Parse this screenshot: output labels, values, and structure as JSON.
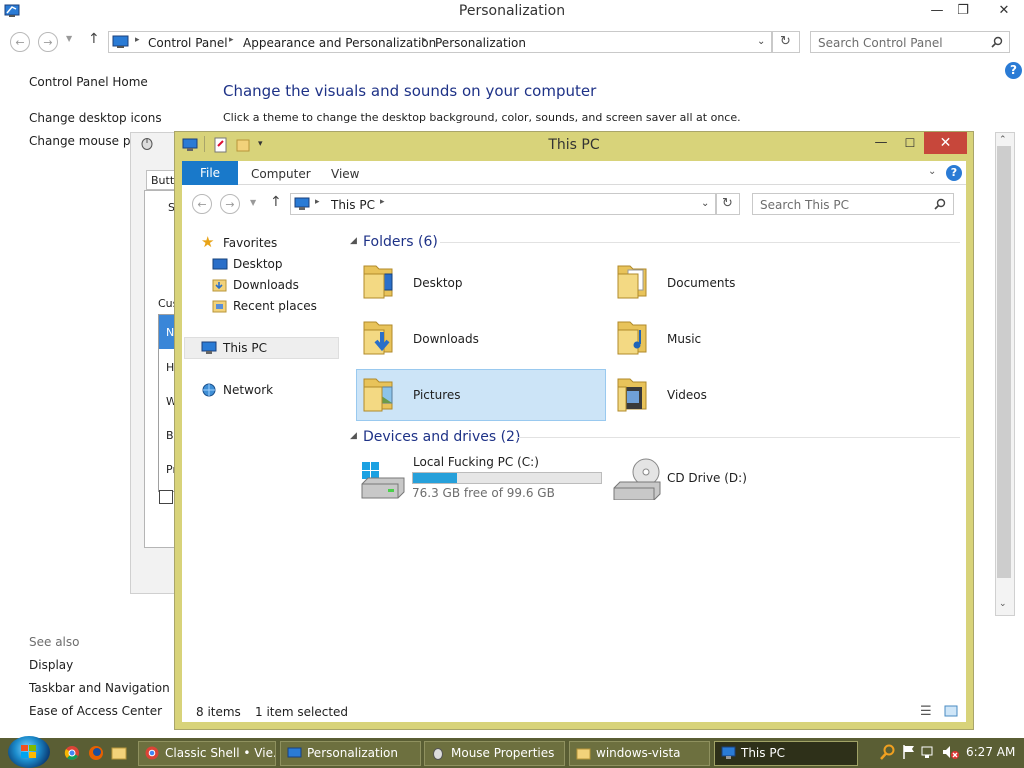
{
  "control_panel": {
    "title": "Personalization",
    "breadcrumb": [
      "Control Panel",
      "Appearance and Personalization",
      "Personalization"
    ],
    "search_placeholder": "Search Control Panel",
    "sidebar_links": [
      "Control Panel Home",
      "Change desktop icons",
      "Change mouse poi"
    ],
    "heading": "Change the visuals and sounds on your computer",
    "description": "Click a theme to change the desktop background, color, sounds, and screen saver all at once.",
    "see_also": {
      "label": "See also",
      "links": [
        "Display",
        "Taskbar and Navigation",
        "Ease of Access Center"
      ]
    },
    "help": "?"
  },
  "mouse_properties": {
    "tab_label": "Butto",
    "list_letters": [
      "N",
      "H",
      "W",
      "B",
      "Pr"
    ],
    "side_labels": [
      "S",
      "Cus"
    ]
  },
  "explorer": {
    "title": "This PC",
    "ribbon_tabs": [
      "File",
      "Computer",
      "View"
    ],
    "address": "This PC",
    "search_placeholder": "Search This PC",
    "nav": {
      "favorites": "Favorites",
      "favorite_items": [
        "Desktop",
        "Downloads",
        "Recent places"
      ],
      "this_pc": "This PC",
      "network": "Network"
    },
    "folders_header": "Folders (6)",
    "folders": [
      "Desktop",
      "Documents",
      "Downloads",
      "Music",
      "Pictures",
      "Videos"
    ],
    "devices_header": "Devices and drives (2)",
    "drives": [
      {
        "name": "Local Fucking PC (C:)",
        "free_text": "76.3 GB free of 99.6 GB",
        "used_fraction": 0.234
      },
      {
        "name": "CD Drive (D:)"
      }
    ],
    "status": {
      "items": "8 items",
      "selected": "1 item selected"
    }
  },
  "taskbar": {
    "buttons": [
      {
        "label": "Classic Shell • Vie..."
      },
      {
        "label": "Personalization"
      },
      {
        "label": "Mouse Properties"
      },
      {
        "label": "windows-vista"
      },
      {
        "label": "This PC"
      }
    ],
    "clock": "6:27 AM"
  },
  "colors": {
    "explorer_frame": "#d8d37a",
    "accent_blue": "#1979ca",
    "close_red": "#c7473b",
    "taskbar": "#5a5e34",
    "selection": "#cce4f7",
    "drive_fill": "#26a0da"
  }
}
